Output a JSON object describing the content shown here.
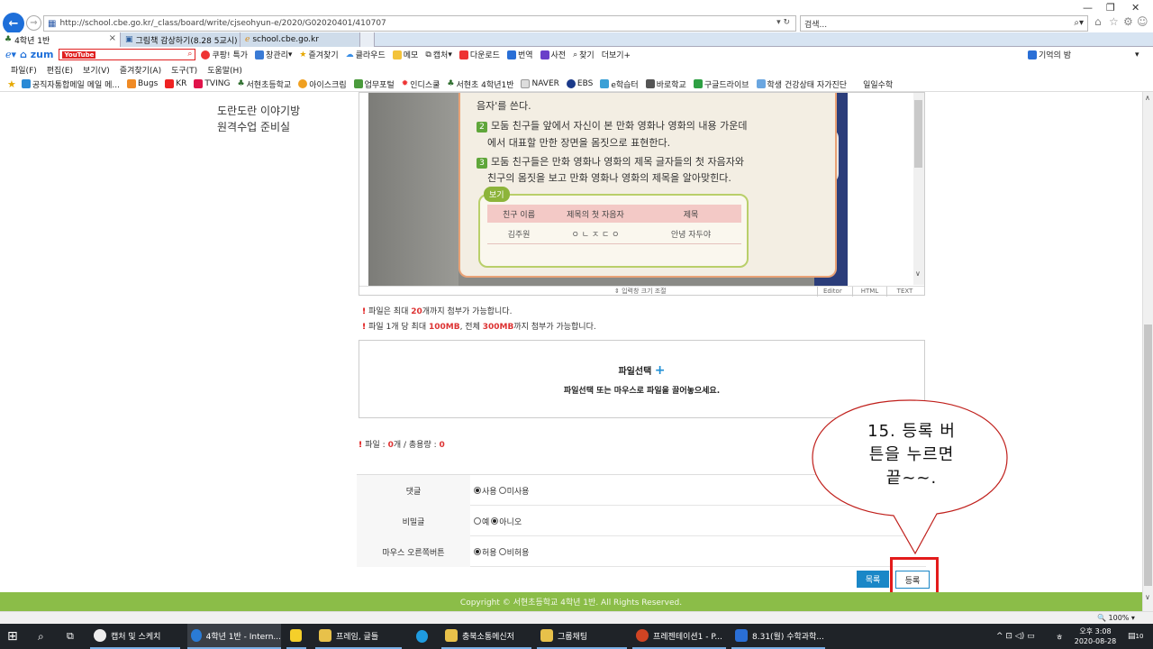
{
  "browser": {
    "address": "http://school.cbe.go.kr/_class/board/write/cjseohyun-e/2020/G02020401/410707",
    "search_placeholder": "검색...",
    "tabs": [
      {
        "label": "4학년 1반"
      },
      {
        "label": "그림책 감상하기(8.28 5교시)"
      },
      {
        "label": "school.cbe.go.kr"
      }
    ],
    "zum_logo": "zum",
    "zum_search_value": "YouTube",
    "zum_items": [
      "쿠팡! 특가",
      "창관리",
      "즐겨찾기",
      "클라우드",
      "메모",
      "캡처",
      "다운로드",
      "번역",
      "사전",
      "찾기",
      "더보기+"
    ],
    "zum_right": "기억의 밤",
    "menu": [
      "파일(F)",
      "편집(E)",
      "보기(V)",
      "즐겨찾기(A)",
      "도구(T)",
      "도움말(H)"
    ],
    "favorites": [
      "공직자통합메일 메일 메...",
      "Bugs",
      "KR",
      "TVING",
      "서현초등학교",
      "아이스크림",
      "업무포털",
      "인디스쿨",
      "서현초 4학년1반",
      "NAVER",
      "EBS",
      "e학습터",
      "바로학교",
      "구글드라이브",
      "학생 건강상태 자가진단",
      "일일수학"
    ]
  },
  "sidebar": {
    "links": [
      "도란도란 이야기방",
      "원격수업 준비실"
    ]
  },
  "editor": {
    "book_lines": [
      "음자'를 쓴다.",
      "모둠 친구들 앞에서 자신이 본 만화 영화나 영화의 내용 가운데",
      "에서 대표할 만한 장면을 몸짓으로 표현한다.",
      "모둠 친구들은 만화 영화나 영화의 제목 글자들의 첫 자음자와",
      "친구의 몸짓을 보고 만화 영화나 영화의 제목을 알아맞힌다."
    ],
    "book_numbers": [
      "2",
      "3"
    ],
    "example_label": "보기",
    "table_headers": [
      "친구 이름",
      "제목의 첫 자음자",
      "제목"
    ],
    "table_row": [
      "김주원",
      "ㅇ ㄴ ㅈ ㄷ ㅇ",
      "안녕 자두야"
    ],
    "resize_label": "입력창 크기 조절",
    "modes": [
      "Editor",
      "HTML",
      "TEXT"
    ]
  },
  "upload": {
    "note1_pre": "파일은 최대 ",
    "note1_num": "20",
    "note1_post": "개까지 첨부가 가능합니다.",
    "note2_pre": "파일 1개 당 최대 ",
    "note2_max": "100MB",
    "note2_mid": ", 전체 ",
    "note2_total": "300MB",
    "note2_post": "까지 첨부가 가능합니다.",
    "title": "파일선택",
    "hint": "파일선택 또는 마우스로 파일을 끌어놓으세요.",
    "file_label": "파일 : ",
    "file_count": "0",
    "file_unit": "개 / 총용량 : ",
    "file_size": "0"
  },
  "options": [
    {
      "label": "댓글",
      "choices": [
        "사용",
        "미사용"
      ],
      "selected": 0
    },
    {
      "label": "비밀글",
      "choices": [
        "예",
        "아니오"
      ],
      "selected": 1
    },
    {
      "label": "마우스 오른쪽버튼",
      "choices": [
        "허용",
        "비허용"
      ],
      "selected": 0
    }
  ],
  "buttons": {
    "list": "목록",
    "register": "등록"
  },
  "footer": "Copyright © 서현초등학교 4학년 1반. All Rights Reserved.",
  "callout": "15. 등록 버튼을 누르면 끝~~.",
  "callout_lines": [
    "15. 등록 버",
    "튼을 누르면",
    "끝~~."
  ],
  "status": {
    "zoom": "100%"
  },
  "taskbar": {
    "items": [
      "캡처 및 스케치",
      "4학년 1반 - Intern...",
      "",
      "프레임, 글틀",
      "",
      "충북소통메신저",
      "그룹채팅",
      "프레젠테이션1 - P...",
      "8.31(월) 수학과학..."
    ],
    "time": "오후 3:08",
    "date": "2020-08-28",
    "ime": "ㅎ",
    "notif": "10"
  },
  "colors": {
    "accent": "#1a87c7",
    "footer": "#8bbd48",
    "highlight": "#e31b1b",
    "note_red": "#d33"
  }
}
